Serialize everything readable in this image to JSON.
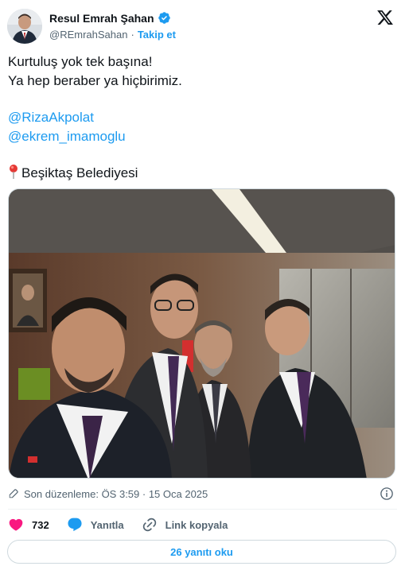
{
  "author": {
    "display_name": "Resul Emrah Şahan",
    "handle": "@REmrahSahan",
    "separator": "·",
    "follow_label": "Takip et"
  },
  "tweet": {
    "line1": "Kurtuluş yok tek başına!",
    "line2": "Ya hep beraber ya hiçbirimiz.",
    "mention1": "@RizaAkpolat",
    "mention2": "@ekrem_imamoglu",
    "location": "Beşiktaş Belediyesi"
  },
  "meta": {
    "edited_text": "Son düzenleme: ÖS 3:59 · 15 Oca 2025"
  },
  "actions": {
    "like_count": "732",
    "reply_label": "Yanıtla",
    "copy_label": "Link kopyala"
  },
  "replies_button": "26 yanıtı oku",
  "colors": {
    "accent": "#1d9bf0",
    "like": "#f91880",
    "text": "#0f1419",
    "secondary": "#536471"
  },
  "icons": [
    "x-logo-icon",
    "verified-badge-icon",
    "pin-icon",
    "pencil-icon",
    "info-icon",
    "heart-icon",
    "reply-bubble-icon",
    "link-icon"
  ]
}
